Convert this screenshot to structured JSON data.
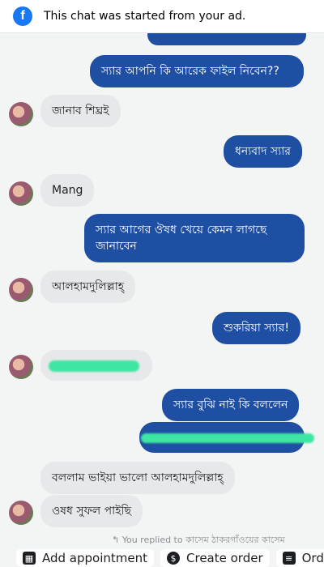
{
  "banner": {
    "icon": "facebook-icon",
    "text": "This chat was started from your ad."
  },
  "messages": [
    {
      "side": "out",
      "text": "স্যার আপনি কি আরেক ফাইল নিবেন??"
    },
    {
      "side": "in",
      "text": "জানাব শিঘ্রই"
    },
    {
      "side": "out",
      "text": "ধন্যবাদ স্যার"
    },
    {
      "side": "in",
      "text": "Mang"
    },
    {
      "side": "out",
      "text": "স্যার আগের ঔষধ খেয়ে কেমন লাগছে"
    },
    {
      "side": "out",
      "text": "জানাবেন"
    },
    {
      "side": "in",
      "text": "আলহামদুলিল্লাহ্"
    },
    {
      "side": "out",
      "text": "শুকরিয়া স্যার!"
    },
    {
      "side": "out",
      "text": "স্যার বুঝি নাই কি বললেন"
    },
    {
      "side": "in",
      "text": "বললাম ভাইয়া ভালো আলহামদুলিল্লাহ্"
    },
    {
      "side": "in",
      "text": "ওষধ সুফল পাইছি"
    }
  ],
  "reply_note": "↰ You replied to কাসেম ঠাকরগাঁওয়ের কাসেম",
  "toolbar": {
    "add_appointment": "Add appointment",
    "create_order": "Create order",
    "order_partial": "Orde"
  },
  "colors": {
    "outgoing": "#1f4fa3",
    "incoming": "#e7e8ea",
    "redaction": "#3fe6a3"
  }
}
